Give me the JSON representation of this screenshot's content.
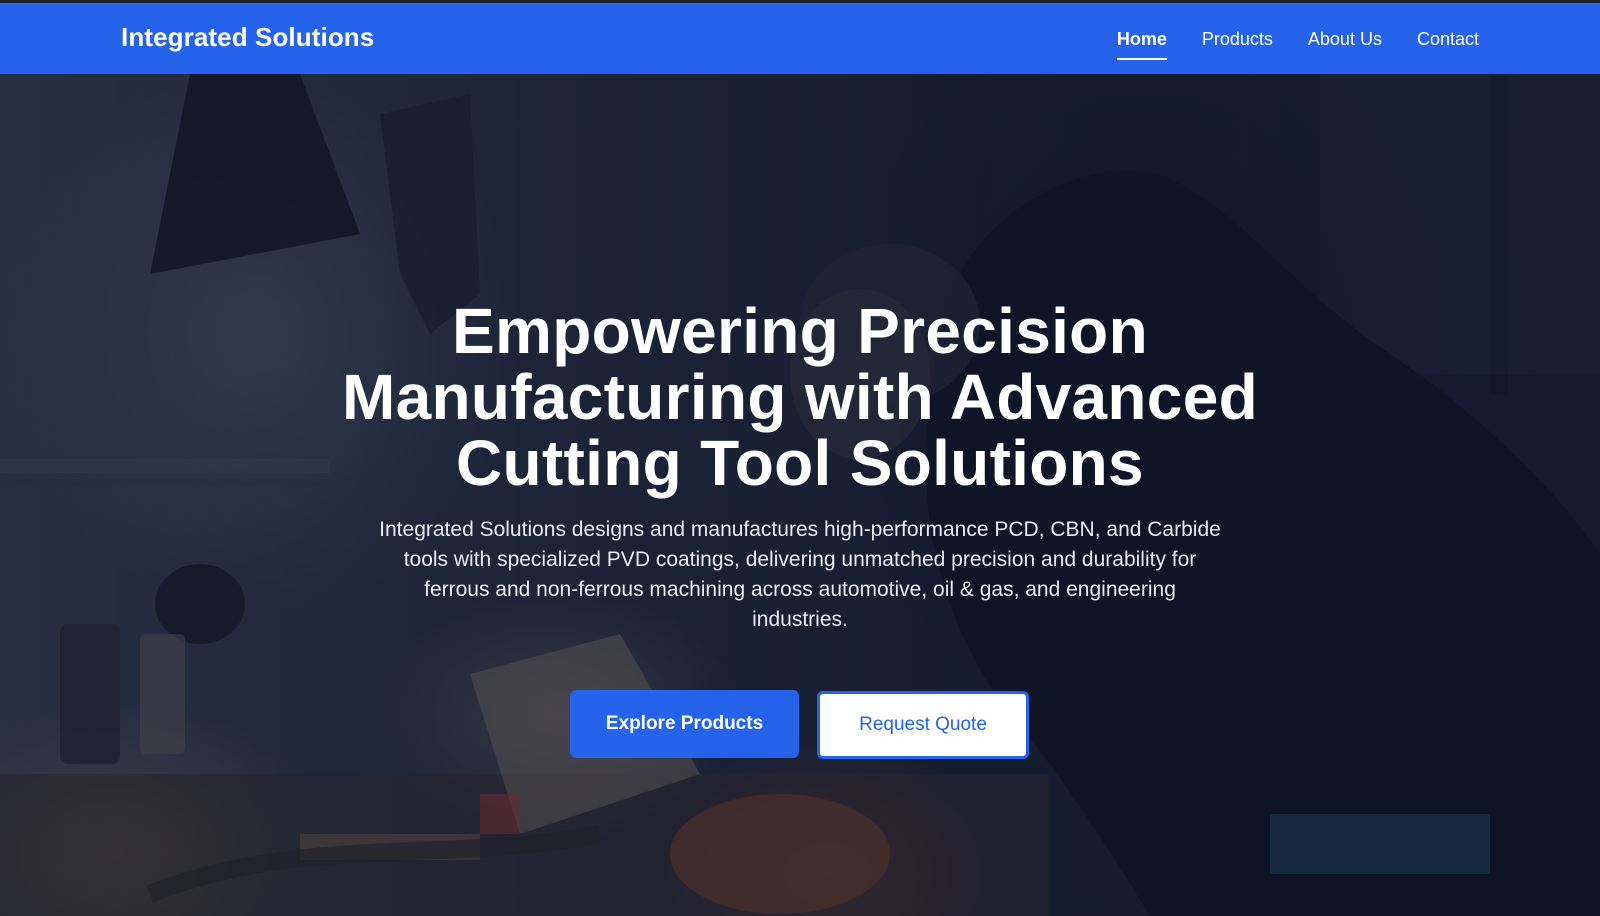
{
  "nav": {
    "brand": "Integrated Solutions",
    "links": [
      {
        "label": "Home",
        "active": true
      },
      {
        "label": "Products",
        "active": false
      },
      {
        "label": "About Us",
        "active": false
      },
      {
        "label": "Contact",
        "active": false
      }
    ]
  },
  "hero": {
    "title": "Empowering Precision Manufacturing with Advanced Cutting Tool Solutions",
    "description": "Integrated Solutions designs and manufactures high-performance PCD, CBN, and Carbide tools with specialized PVD coatings, delivering unmatched precision and durability for ferrous and non-ferrous machining across automotive, oil & gas, and engineering industries.",
    "primary_button": "Explore Products",
    "secondary_button": "Request Quote",
    "background_image": "workshop-machinist-photo"
  },
  "colors": {
    "accent": "#2563eb",
    "nav_text": "#ffffff",
    "overlay": "#0f1428"
  }
}
